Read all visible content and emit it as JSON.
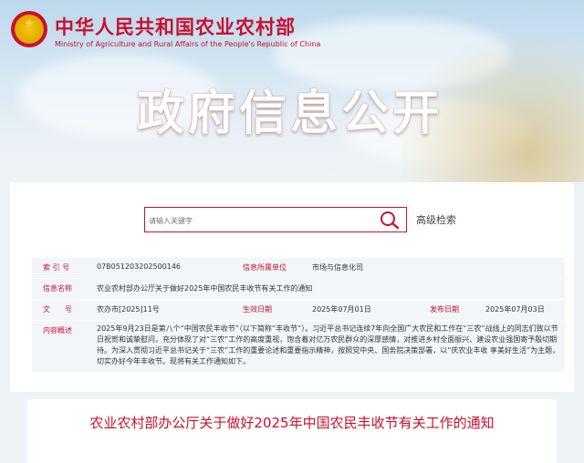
{
  "header": {
    "ministry_cn": "中华人民共和国农业农村部",
    "ministry_en": "Ministry of Agriculture and Rural Affairs of the People's Republic of China",
    "headline": "政府信息公开"
  },
  "search": {
    "placeholder": "请输入关键字",
    "advanced_label": "高级检索"
  },
  "meta": {
    "index_label": "索 引 号",
    "index_value": "07B051203202500146",
    "source_label": "信息所属单位",
    "source_value": "市场与信息化司",
    "name_label": "信息名称",
    "name_value": "农业农村部办公厅关于做好2025年中国农民丰收节有关工作的通知",
    "docno_label": "文　　号",
    "docno_value": "农办市[2025]11号",
    "effective_label": "生效日期",
    "effective_value": "2025年07月01日",
    "publish_label": "发布日期",
    "publish_value": "2025年07月03日",
    "summary_label": "内容概述",
    "summary_value": "2025年9月23日是第八个“中国农民丰收节”（以下简称“丰收节”）。习近平总书记连续7年向全国广大农民和工作在“三农”战线上的同志们致以节日祝贺和诚挚慰问，充分体现了对“三农”工作的高度重视，饱含着对亿万农民群众的深厚感情，对推进乡村全面振兴、建设农业强国寄予殷切期待。为深入贯彻习近平总书记关于“三农”工作的重要论述和重要指示精神，按照党中央、国务院决策部署，以“庆农业丰收 享美好生活”为主题，切实办好今年丰收节。现将有关工作通知如下。"
  },
  "document": {
    "title": "农业农村部办公厅关于做好2025年中国农民丰收节有关工作的通知"
  },
  "colors": {
    "accent": "#c8102e",
    "row_bg": "#f2f6f9"
  },
  "icons": {
    "search": "magnifier-icon",
    "emblem": "national-emblem-icon"
  }
}
